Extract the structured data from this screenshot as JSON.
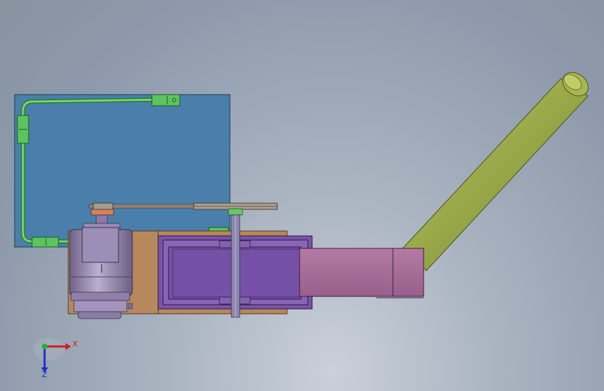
{
  "triad": {
    "x_label": "X",
    "z_label": "Z",
    "x_color": "#c82020",
    "z_color": "#2030c8",
    "origin_color": "#20b040"
  },
  "colors": {
    "blue_plate": "#4a7fab",
    "green_pipe": "#58c45a",
    "motor": "#9a8ab2",
    "base": "#b7885c",
    "frame_purple": "#7a54a8",
    "chute_pink": "#a76a9b",
    "tube_olive": "#98a848",
    "belt": "#a08f80"
  }
}
